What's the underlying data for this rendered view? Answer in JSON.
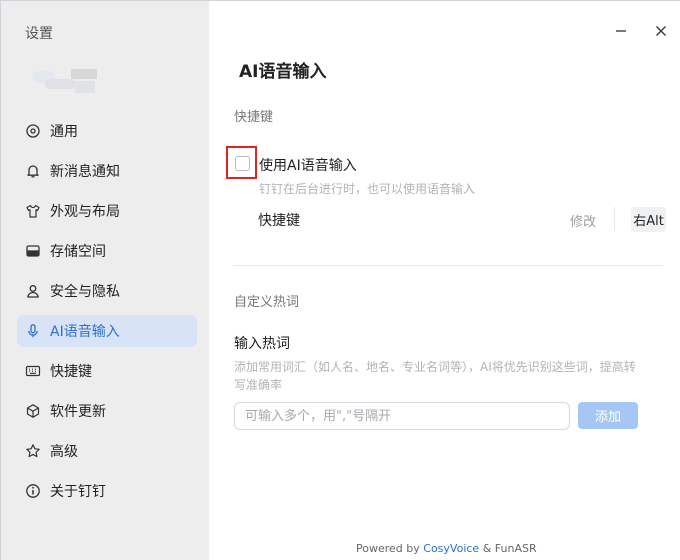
{
  "sidebar": {
    "title": "设置",
    "items": [
      {
        "label": "通用",
        "icon": "target-icon"
      },
      {
        "label": "新消息通知",
        "icon": "bell-icon"
      },
      {
        "label": "外观与布局",
        "icon": "shirt-icon"
      },
      {
        "label": "存储空间",
        "icon": "storage-icon"
      },
      {
        "label": "安全与隐私",
        "icon": "user-icon"
      },
      {
        "label": "AI语音输入",
        "icon": "microphone-icon",
        "active": true
      },
      {
        "label": "快捷键",
        "icon": "keyboard-icon"
      },
      {
        "label": "软件更新",
        "icon": "cube-icon"
      },
      {
        "label": "高级",
        "icon": "star-icon"
      },
      {
        "label": "关于钉钉",
        "icon": "info-icon"
      }
    ]
  },
  "main": {
    "title": "AI语音输入",
    "shortcut_section": {
      "label": "快捷键",
      "toggle_label": "使用AI语音输入",
      "toggle_checked": false,
      "hint": "钉钉在后台进行时，也可以使用语音输入",
      "shortcut_label": "快捷键",
      "modify_label": "修改",
      "key": "右Alt"
    },
    "hotword_section": {
      "label": "自定义热词",
      "title": "输入热词",
      "description": "添加常用词汇（如人名、地名、专业名词等），AI将优先识别这些词，提高转写准确率",
      "input_placeholder": "可输入多个，用\",\"号隔开",
      "input_value": "",
      "add_label": "添加"
    }
  },
  "footer": {
    "prefix": "Powered by ",
    "brand": "CosyVoice",
    "suffix": " & FunASR"
  },
  "colors": {
    "accent": "#2b6fd6",
    "active_bg": "#d8e4f5",
    "sidebar_bg": "#ededee",
    "highlight_border": "#e0241e",
    "add_button_bg": "#a6c7f5"
  }
}
